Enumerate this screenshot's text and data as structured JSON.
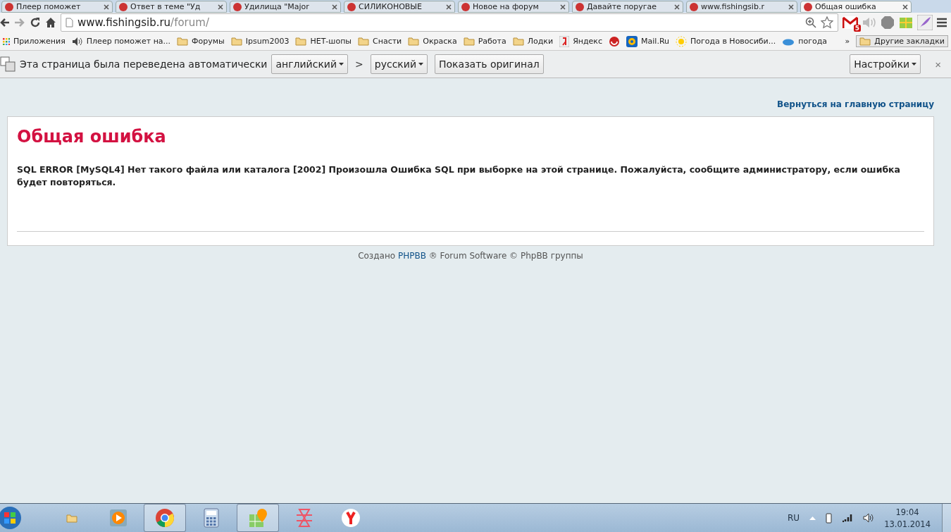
{
  "browser": {
    "tabs": [
      {
        "title": "Плеер поможет",
        "selected": false
      },
      {
        "title": "Ответ в теме \"Уд",
        "selected": false
      },
      {
        "title": "Удилища \"Major",
        "selected": false
      },
      {
        "title": "СИЛИКОНОВЫЕ",
        "selected": false
      },
      {
        "title": "Новое на форум",
        "selected": false
      },
      {
        "title": "Давайте поругае",
        "selected": false
      },
      {
        "title": "www.fishingsib.r",
        "selected": false
      },
      {
        "title": "Общая ошибка",
        "selected": true
      }
    ],
    "address": {
      "domain": "www.fishingsib.ru",
      "path": "/forum/"
    },
    "mail_badge": "5",
    "bookmarks": [
      {
        "label": "Приложения",
        "kind": "apps"
      },
      {
        "label": "Плеер поможет на...",
        "kind": "sound"
      },
      {
        "label": "Форумы",
        "kind": "folder"
      },
      {
        "label": "Ipsum2003",
        "kind": "folder"
      },
      {
        "label": "НЕТ-шопы",
        "kind": "folder"
      },
      {
        "label": "Снасти",
        "kind": "folder"
      },
      {
        "label": "Окраска",
        "kind": "folder"
      },
      {
        "label": "Работа",
        "kind": "folder"
      },
      {
        "label": "Лодки",
        "kind": "folder"
      },
      {
        "label": "Яндекс",
        "kind": "yandex"
      },
      {
        "kind": "site"
      },
      {
        "label": "Mail.Ru",
        "kind": "mail"
      },
      {
        "label": "Погода в Новосиби...",
        "kind": "sun"
      },
      {
        "label": "погода",
        "kind": "weather"
      }
    ],
    "more": "»",
    "other_bookmarks": "Другие закладки"
  },
  "translate_bar": {
    "message": "Эта страница была переведена автоматически",
    "from": "английский",
    "separator": ">",
    "to": "русский",
    "show_original": "Показать оригинал",
    "settings": "Настройки",
    "close": "×"
  },
  "page": {
    "back_link": "Вернуться на главную страницу",
    "title": "Общая ошибка",
    "message": "SQL ERROR [MySQL4] Нет такого файла или каталога [2002] Произошла Ошибка SQL при выборке на этой странице. Пожалуйста, сообщите администратору, если ошибка будет повторяться.",
    "footer": {
      "prefix": "Создано",
      "link": "PHPBB",
      "suffix": "® Forum Software © PhpBB группы"
    }
  },
  "taskbar": {
    "apps": [
      {
        "kind": "explorer",
        "open": false
      },
      {
        "kind": "media",
        "open": false
      },
      {
        "kind": "chrome",
        "open": true
      },
      {
        "kind": "calculator",
        "open": false
      },
      {
        "kind": "maps",
        "open": true
      },
      {
        "kind": "zune",
        "open": false
      },
      {
        "kind": "yandex",
        "open": false
      }
    ],
    "language": "RU",
    "time": "19:04",
    "date": "13.01.2014"
  }
}
